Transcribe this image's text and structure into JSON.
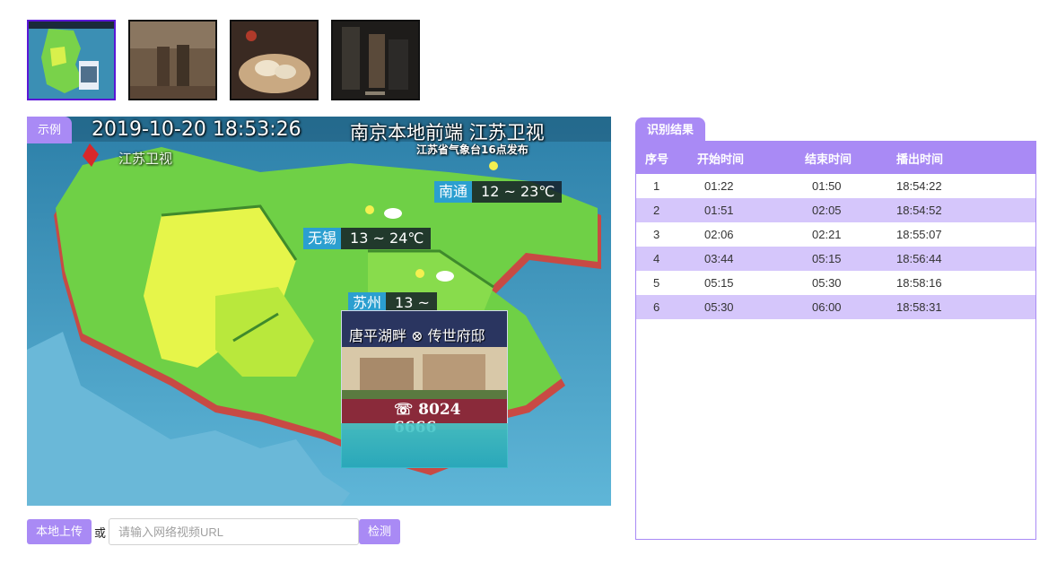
{
  "thumbnails": [
    {
      "label": "weather-map-thumbnail",
      "active": true
    },
    {
      "label": "outdoor-scene-thumbnail",
      "active": false
    },
    {
      "label": "food-scene-thumbnail",
      "active": false
    },
    {
      "label": "dark-indoor-scene-thumbnail",
      "active": false
    }
  ],
  "example_tag": "示例",
  "video": {
    "timestamp": "2019-10-20 18:53:26",
    "channel_caption": "南京本地前端 江苏卫视",
    "logo_text": "江苏卫视",
    "release_note": "江苏省气象台16点发布",
    "temps": [
      {
        "city": "南通",
        "range": "12 ~ 23℃"
      },
      {
        "city": "无锡",
        "range": "13 ~ 24℃"
      },
      {
        "city": "苏州",
        "range": "13 ~"
      }
    ],
    "ad": {
      "headline": "唐平湖畔 ⊗ 传世府邸",
      "phone": "☏ 8024 6666"
    }
  },
  "upload": {
    "local_button": "本地上传",
    "or_text": "或",
    "url_placeholder": "请输入网络视频URL",
    "url_value": "",
    "detect_button": "检测"
  },
  "results": {
    "tag": "识别结果",
    "columns": [
      "序号",
      "开始时间",
      "结束时间",
      "播出时间"
    ],
    "rows": [
      [
        "1",
        "01:22",
        "01:50",
        "18:54:22"
      ],
      [
        "2",
        "01:51",
        "02:05",
        "18:54:52"
      ],
      [
        "3",
        "02:06",
        "02:21",
        "18:55:07"
      ],
      [
        "4",
        "03:44",
        "05:15",
        "18:56:44"
      ],
      [
        "5",
        "05:15",
        "05:30",
        "18:58:16"
      ],
      [
        "6",
        "05:30",
        "06:00",
        "18:58:31"
      ]
    ]
  },
  "colors": {
    "accent": "#a98af5",
    "row_alt": "#d5c6fb",
    "active_border": "#5a17d6"
  }
}
